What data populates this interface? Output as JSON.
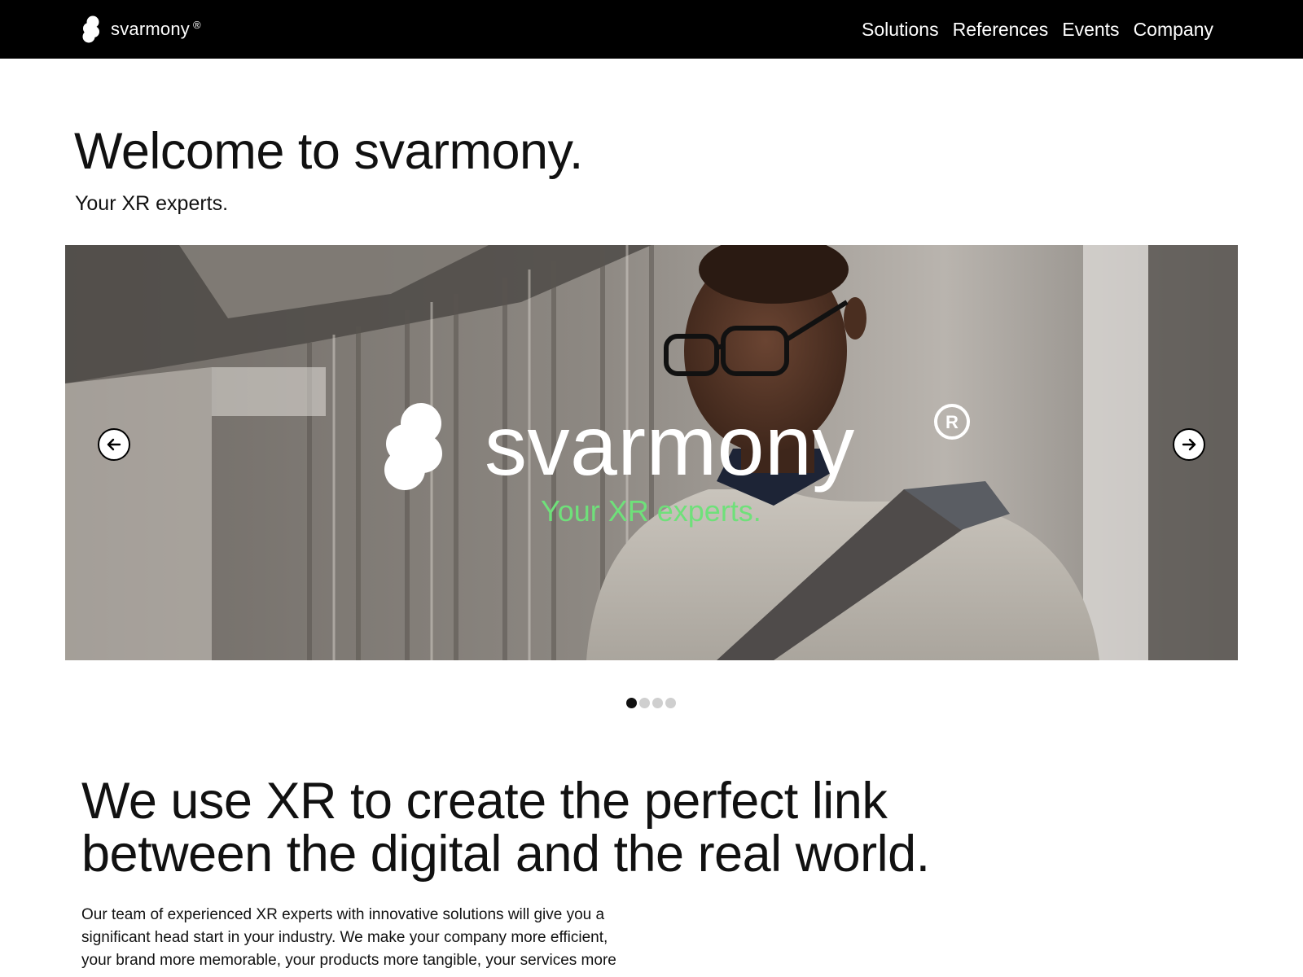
{
  "header": {
    "brand_name": "svarmony",
    "brand_reg": "®",
    "nav": [
      {
        "label": "Solutions"
      },
      {
        "label": "References"
      },
      {
        "label": "Events"
      },
      {
        "label": "Company"
      }
    ]
  },
  "hero": {
    "title": "Welcome to svarmony.",
    "subtitle": "Your XR experts."
  },
  "carousel": {
    "slide_brand": "svarmony",
    "slide_tagline": "Your XR experts.",
    "prev_icon": "arrow-left-icon",
    "next_icon": "arrow-right-icon",
    "slide_count": 4,
    "active_slide": 1
  },
  "section": {
    "title": "We use XR to create the perfect link between the digital and the real world.",
    "body": "Our team of experienced XR experts with innovative solutions will give you a significant head start in your industry. We make your company more efficient, your brand more memorable, your products more tangible, your services more"
  },
  "colors": {
    "nav_bg": "#000000",
    "accent_green": "#6fe07a",
    "text": "#111111"
  }
}
